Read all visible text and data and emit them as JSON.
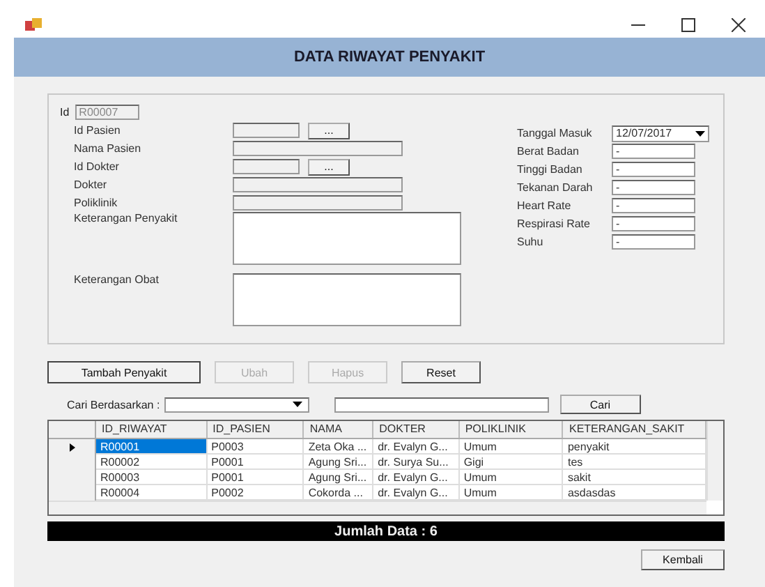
{
  "window": {
    "title": "DATA RIWAYAT PENYAKIT"
  },
  "form_left": [
    {
      "kind": "lookup",
      "label": "Id Pasien",
      "button": "..."
    },
    {
      "kind": "text",
      "label": "Nama Pasien"
    },
    {
      "kind": "lookup",
      "label": "Id Dokter",
      "button": "..."
    },
    {
      "kind": "text",
      "label": "Dokter"
    },
    {
      "kind": "text",
      "label": "Poliklinik"
    },
    {
      "kind": "area",
      "label": "Keterangan Penyakit"
    },
    {
      "kind": "area",
      "label": "Keterangan Obat"
    }
  ],
  "id_field": {
    "label": "Id",
    "value": "R00007",
    "disabled": true
  },
  "form_right": [
    {
      "kind": "date",
      "label": "Tanggal Masuk",
      "value": "12/07/2017"
    },
    {
      "kind": "text",
      "label": "Berat Badan",
      "value": "-"
    },
    {
      "kind": "text",
      "label": "Tinggi Badan",
      "value": "-"
    },
    {
      "kind": "text",
      "label": "Tekanan Darah",
      "value": "-"
    },
    {
      "kind": "text",
      "label": "Heart Rate",
      "value": "-"
    },
    {
      "kind": "text",
      "label": "Respirasi Rate",
      "value": "-"
    },
    {
      "kind": "text",
      "label": "Suhu",
      "value": "-"
    }
  ],
  "buttons": [
    {
      "label": "Tambah Penyakit",
      "disabled": false
    },
    {
      "label": "Ubah",
      "disabled": true
    },
    {
      "label": "Hapus",
      "disabled": true
    },
    {
      "label": "Reset",
      "disabled": false
    }
  ],
  "search": {
    "label": "Cari Berdasarkan :",
    "button": "Cari"
  },
  "table": {
    "columns": [
      "ID_RIWAYAT",
      "ID_PASIEN",
      "NAMA",
      "DOKTER",
      "POLIKLINIK",
      "KETERANGAN_SAKIT"
    ],
    "rows": [
      {
        "selected": true,
        "cells": [
          "R00001",
          "P0003",
          "Zeta Oka ...",
          "dr. Evalyn G...",
          "Umum",
          "penyakit"
        ]
      },
      {
        "selected": false,
        "cells": [
          "R00002",
          "P0001",
          "Agung Sri...",
          "dr. Surya Su...",
          "Gigi",
          "tes"
        ]
      },
      {
        "selected": false,
        "cells": [
          "R00003",
          "P0001",
          "Agung Sri...",
          "dr. Evalyn G...",
          "Umum",
          "sakit"
        ]
      },
      {
        "selected": false,
        "cells": [
          "R00004",
          "P0002",
          "Cokorda ...",
          "dr. Evalyn G...",
          "Umum",
          "asdasdas"
        ]
      }
    ]
  },
  "total": "Jumlah Data : 6",
  "back_button": "Kembali"
}
